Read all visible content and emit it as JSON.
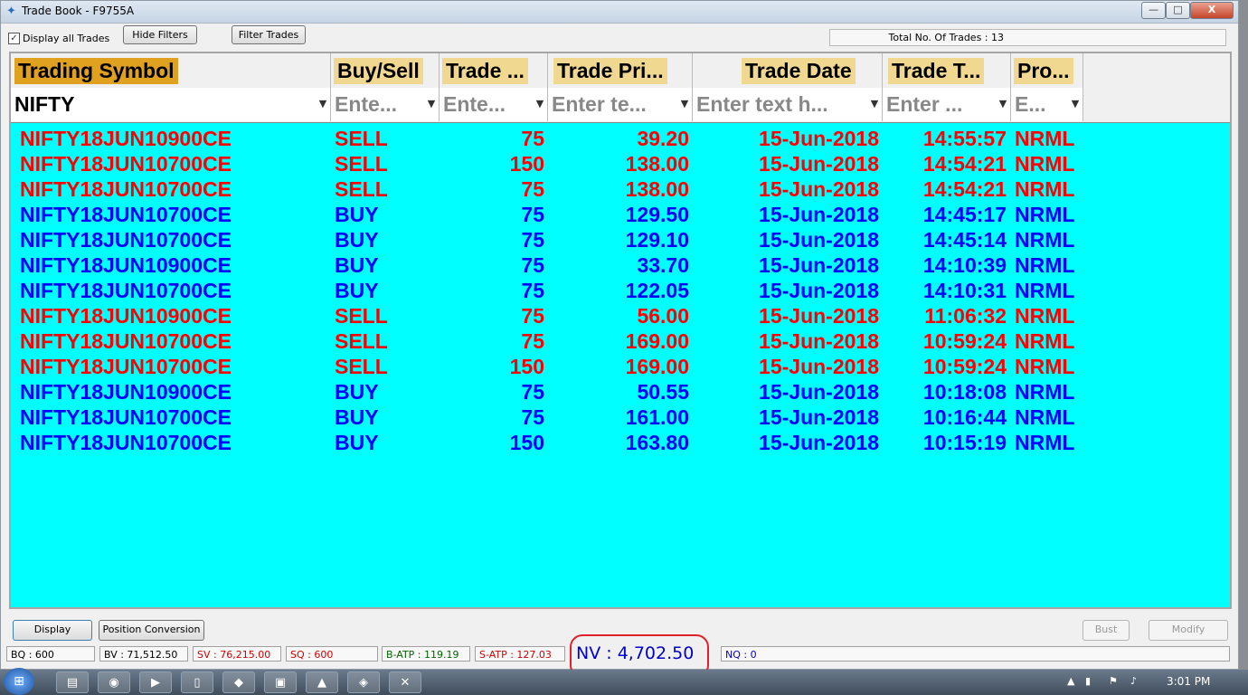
{
  "window": {
    "title": "Trade Book - F9755A",
    "minimize": "—",
    "maximize": "□",
    "close": "X"
  },
  "toolbar": {
    "display_all_trades": "Display all Trades",
    "checkbox_mark": "✓",
    "hide_filters": "Hide Filters",
    "filter_trades": "Filter Trades",
    "total_trades": "Total No. Of Trades : 13"
  },
  "grid": {
    "headers": [
      "Trading Symbol",
      "Buy/Sell",
      "Trade ...",
      "Trade Pri...",
      "Trade Date",
      "Trade T...",
      "Pro..."
    ],
    "filters": [
      "NIFTY",
      "Ente...",
      "Ente...",
      "Enter te...",
      "Enter text h...",
      "Enter ...",
      "E..."
    ],
    "rows": [
      {
        "symbol": "NIFTY18JUN10900CE",
        "side": "SELL",
        "qty": "75",
        "price": "39.20",
        "date": "15-Jun-2018",
        "time": "14:55:57",
        "product": "NRML"
      },
      {
        "symbol": "NIFTY18JUN10700CE",
        "side": "SELL",
        "qty": "150",
        "price": "138.00",
        "date": "15-Jun-2018",
        "time": "14:54:21",
        "product": "NRML"
      },
      {
        "symbol": "NIFTY18JUN10700CE",
        "side": "SELL",
        "qty": "75",
        "price": "138.00",
        "date": "15-Jun-2018",
        "time": "14:54:21",
        "product": "NRML"
      },
      {
        "symbol": "NIFTY18JUN10700CE",
        "side": "BUY",
        "qty": "75",
        "price": "129.50",
        "date": "15-Jun-2018",
        "time": "14:45:17",
        "product": "NRML"
      },
      {
        "symbol": "NIFTY18JUN10700CE",
        "side": "BUY",
        "qty": "75",
        "price": "129.10",
        "date": "15-Jun-2018",
        "time": "14:45:14",
        "product": "NRML"
      },
      {
        "symbol": "NIFTY18JUN10900CE",
        "side": "BUY",
        "qty": "75",
        "price": "33.70",
        "date": "15-Jun-2018",
        "time": "14:10:39",
        "product": "NRML"
      },
      {
        "symbol": "NIFTY18JUN10700CE",
        "side": "BUY",
        "qty": "75",
        "price": "122.05",
        "date": "15-Jun-2018",
        "time": "14:10:31",
        "product": "NRML"
      },
      {
        "symbol": "NIFTY18JUN10900CE",
        "side": "SELL",
        "qty": "75",
        "price": "56.00",
        "date": "15-Jun-2018",
        "time": "11:06:32",
        "product": "NRML"
      },
      {
        "symbol": "NIFTY18JUN10700CE",
        "side": "SELL",
        "qty": "75",
        "price": "169.00",
        "date": "15-Jun-2018",
        "time": "10:59:24",
        "product": "NRML"
      },
      {
        "symbol": "NIFTY18JUN10700CE",
        "side": "SELL",
        "qty": "150",
        "price": "169.00",
        "date": "15-Jun-2018",
        "time": "10:59:24",
        "product": "NRML"
      },
      {
        "symbol": "NIFTY18JUN10900CE",
        "side": "BUY",
        "qty": "75",
        "price": "50.55",
        "date": "15-Jun-2018",
        "time": "10:18:08",
        "product": "NRML"
      },
      {
        "symbol": "NIFTY18JUN10700CE",
        "side": "BUY",
        "qty": "75",
        "price": "161.00",
        "date": "15-Jun-2018",
        "time": "10:16:44",
        "product": "NRML"
      },
      {
        "symbol": "NIFTY18JUN10700CE",
        "side": "BUY",
        "qty": "150",
        "price": "163.80",
        "date": "15-Jun-2018",
        "time": "10:15:19",
        "product": "NRML"
      }
    ]
  },
  "bottom": {
    "display": "Display",
    "position_conversion": "Position Conversion",
    "bust": "Bust",
    "modify": "Modify"
  },
  "status": {
    "bq": "BQ : 600",
    "bv": "BV : 71,512.50",
    "sv": "SV : 76,215.00",
    "sq": "SQ : 600",
    "batp": "B-ATP : 119.19",
    "satp": "S-ATP : 127.03",
    "nv": "NV : 4,702.50",
    "nq": "NQ : 0"
  },
  "taskbar": {
    "time": "3:01 PM"
  },
  "colors": {
    "grid_bg": "#00ffff",
    "sell": "#ff0000",
    "buy": "#0000ff",
    "header_highlight": "#f0d890",
    "symbol_header": "#e0a020"
  }
}
